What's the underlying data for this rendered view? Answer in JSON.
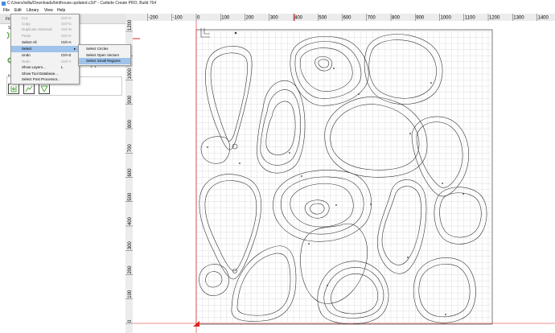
{
  "window": {
    "title": "C:/Users/willa/Downloads/birdhouse.updated.c2d* - Carbide Create PRO, Build 764"
  },
  "menu": {
    "file": "File",
    "edit": "Edit",
    "library": "Library",
    "view": "View",
    "help": "Help"
  },
  "left_panel": {
    "tab_visible": "Fini",
    "side_labels": [
      "Se",
      "C",
      "Ir"
    ]
  },
  "edit_menu": {
    "items": [
      {
        "label": "Cut",
        "shortcut": "Ctrl+X",
        "disabled": true
      },
      {
        "label": "Copy",
        "shortcut": "Ctrl+C",
        "disabled": true
      },
      {
        "label": "Duplicate Selected",
        "shortcut": "Ctrl+D",
        "disabled": true
      },
      {
        "label": "Paste",
        "shortcut": "Ctrl+V",
        "disabled": true
      },
      {
        "label": "Select All",
        "shortcut": "Ctrl+A",
        "disabled": false
      },
      {
        "label": "Select",
        "shortcut": "",
        "disabled": false,
        "highlighted": true,
        "has_submenu": true
      },
      {
        "label": "Undo",
        "shortcut": "Ctrl+Z",
        "disabled": false
      },
      {
        "label": "Redo",
        "shortcut": "Ctrl+Y",
        "disabled": true
      },
      {
        "label": "Show Layers...",
        "shortcut": "L",
        "disabled": false
      },
      {
        "label": "Show Tool Database...",
        "shortcut": "",
        "disabled": false
      },
      {
        "label": "Select Post Processor...",
        "shortcut": "",
        "disabled": false
      }
    ]
  },
  "select_submenu": {
    "items": [
      {
        "label": "Select Circles"
      },
      {
        "label": "Select Open Vectors"
      },
      {
        "label": "Select Small Regions",
        "highlighted": true
      }
    ]
  },
  "ruler_x": {
    "labels": [
      "-200",
      "-100",
      "0",
      "100",
      "200",
      "300",
      "400",
      "500",
      "600",
      "700",
      "800",
      "900",
      "1000",
      "1100",
      "1200",
      "1300",
      "1400"
    ],
    "values": [
      -200,
      -100,
      0,
      100,
      200,
      300,
      400,
      500,
      600,
      700,
      800,
      900,
      1000,
      1100,
      1200,
      1300,
      1400
    ]
  },
  "ruler_y": {
    "labels": [
      "1200",
      "1100",
      "1000",
      "900",
      "800",
      "700",
      "600",
      "500",
      "400",
      "300",
      "200",
      "100",
      "0"
    ],
    "values": [
      1200,
      1100,
      1000,
      900,
      800,
      700,
      600,
      500,
      400,
      300,
      200,
      100,
      0
    ]
  },
  "colors": {
    "accent_green": "#5aa845",
    "origin_red": "#e02020",
    "highlight": "#9fc3ea"
  }
}
